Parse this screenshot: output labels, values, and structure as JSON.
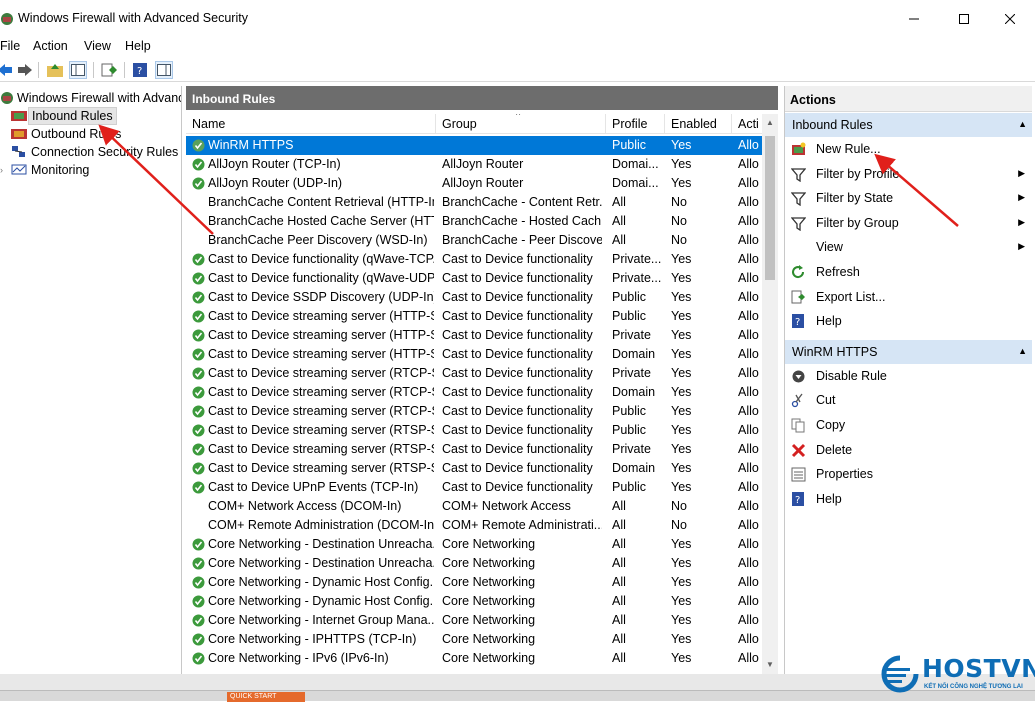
{
  "window": {
    "title": "Windows Firewall with Advanced Security"
  },
  "menu": [
    "File",
    "Action",
    "View",
    "Help"
  ],
  "tree": [
    {
      "label": "Windows Firewall with Advance"
    },
    {
      "label": "Inbound Rules"
    },
    {
      "label": "Outbound Rules"
    },
    {
      "label": "Connection Security Rules"
    },
    {
      "label": "Monitoring"
    }
  ],
  "center": {
    "title": "Inbound Rules",
    "columns": {
      "name": "Name",
      "group": "Group",
      "profile": "Profile",
      "enabled": "Enabled",
      "action": "Acti"
    },
    "rows": [
      {
        "name": "WinRM HTTPS",
        "group": "",
        "profile": "Public",
        "enabled": "Yes",
        "action": "Allo",
        "icon": "check-icon",
        "selected": true
      },
      {
        "name": "AllJoyn Router (TCP-In)",
        "group": "AllJoyn Router",
        "profile": "Domai...",
        "enabled": "Yes",
        "action": "Allo",
        "icon": "check-icon"
      },
      {
        "name": "AllJoyn Router (UDP-In)",
        "group": "AllJoyn Router",
        "profile": "Domai...",
        "enabled": "Yes",
        "action": "Allo",
        "icon": "check-icon"
      },
      {
        "name": "BranchCache Content Retrieval (HTTP-In)",
        "group": "BranchCache - Content Retr...",
        "profile": "All",
        "enabled": "No",
        "action": "Allo",
        "icon": ""
      },
      {
        "name": "BranchCache Hosted Cache Server (HTT...",
        "group": "BranchCache - Hosted Cach...",
        "profile": "All",
        "enabled": "No",
        "action": "Allo",
        "icon": ""
      },
      {
        "name": "BranchCache Peer Discovery (WSD-In)",
        "group": "BranchCache - Peer Discove...",
        "profile": "All",
        "enabled": "No",
        "action": "Allo",
        "icon": ""
      },
      {
        "name": "Cast to Device functionality (qWave-TCP...",
        "group": "Cast to Device functionality",
        "profile": "Private...",
        "enabled": "Yes",
        "action": "Allo",
        "icon": "check-icon"
      },
      {
        "name": "Cast to Device functionality (qWave-UDP...",
        "group": "Cast to Device functionality",
        "profile": "Private...",
        "enabled": "Yes",
        "action": "Allo",
        "icon": "check-icon"
      },
      {
        "name": "Cast to Device SSDP Discovery (UDP-In)",
        "group": "Cast to Device functionality",
        "profile": "Public",
        "enabled": "Yes",
        "action": "Allo",
        "icon": "check-icon"
      },
      {
        "name": "Cast to Device streaming server (HTTP-St...",
        "group": "Cast to Device functionality",
        "profile": "Public",
        "enabled": "Yes",
        "action": "Allo",
        "icon": "check-icon"
      },
      {
        "name": "Cast to Device streaming server (HTTP-St...",
        "group": "Cast to Device functionality",
        "profile": "Private",
        "enabled": "Yes",
        "action": "Allo",
        "icon": "check-icon"
      },
      {
        "name": "Cast to Device streaming server (HTTP-St...",
        "group": "Cast to Device functionality",
        "profile": "Domain",
        "enabled": "Yes",
        "action": "Allo",
        "icon": "check-icon"
      },
      {
        "name": "Cast to Device streaming server (RTCP-St...",
        "group": "Cast to Device functionality",
        "profile": "Private",
        "enabled": "Yes",
        "action": "Allo",
        "icon": "check-icon"
      },
      {
        "name": "Cast to Device streaming server (RTCP-St...",
        "group": "Cast to Device functionality",
        "profile": "Domain",
        "enabled": "Yes",
        "action": "Allo",
        "icon": "check-icon"
      },
      {
        "name": "Cast to Device streaming server (RTCP-St...",
        "group": "Cast to Device functionality",
        "profile": "Public",
        "enabled": "Yes",
        "action": "Allo",
        "icon": "check-icon"
      },
      {
        "name": "Cast to Device streaming server (RTSP-Str...",
        "group": "Cast to Device functionality",
        "profile": "Public",
        "enabled": "Yes",
        "action": "Allo",
        "icon": "check-icon"
      },
      {
        "name": "Cast to Device streaming server (RTSP-Str...",
        "group": "Cast to Device functionality",
        "profile": "Private",
        "enabled": "Yes",
        "action": "Allo",
        "icon": "check-icon"
      },
      {
        "name": "Cast to Device streaming server (RTSP-Str...",
        "group": "Cast to Device functionality",
        "profile": "Domain",
        "enabled": "Yes",
        "action": "Allo",
        "icon": "check-icon"
      },
      {
        "name": "Cast to Device UPnP Events (TCP-In)",
        "group": "Cast to Device functionality",
        "profile": "Public",
        "enabled": "Yes",
        "action": "Allo",
        "icon": "check-icon"
      },
      {
        "name": "COM+ Network Access (DCOM-In)",
        "group": "COM+ Network Access",
        "profile": "All",
        "enabled": "No",
        "action": "Allo",
        "icon": ""
      },
      {
        "name": "COM+ Remote Administration (DCOM-In)",
        "group": "COM+ Remote Administrati...",
        "profile": "All",
        "enabled": "No",
        "action": "Allo",
        "icon": ""
      },
      {
        "name": "Core Networking - Destination Unreacha...",
        "group": "Core Networking",
        "profile": "All",
        "enabled": "Yes",
        "action": "Allo",
        "icon": "check-icon"
      },
      {
        "name": "Core Networking - Destination Unreacha...",
        "group": "Core Networking",
        "profile": "All",
        "enabled": "Yes",
        "action": "Allo",
        "icon": "check-icon"
      },
      {
        "name": "Core Networking - Dynamic Host Config...",
        "group": "Core Networking",
        "profile": "All",
        "enabled": "Yes",
        "action": "Allo",
        "icon": "check-icon"
      },
      {
        "name": "Core Networking - Dynamic Host Config...",
        "group": "Core Networking",
        "profile": "All",
        "enabled": "Yes",
        "action": "Allo",
        "icon": "check-icon"
      },
      {
        "name": "Core Networking - Internet Group Mana...",
        "group": "Core Networking",
        "profile": "All",
        "enabled": "Yes",
        "action": "Allo",
        "icon": "check-icon"
      },
      {
        "name": "Core Networking - IPHTTPS (TCP-In)",
        "group": "Core Networking",
        "profile": "All",
        "enabled": "Yes",
        "action": "Allo",
        "icon": "check-icon"
      },
      {
        "name": "Core Networking - IPv6 (IPv6-In)",
        "group": "Core Networking",
        "profile": "All",
        "enabled": "Yes",
        "action": "Allo",
        "icon": "check-icon"
      }
    ]
  },
  "actions": {
    "header": "Actions",
    "sections": [
      {
        "title": "Inbound Rules",
        "items": [
          {
            "label": "New Rule...",
            "icon": "new-rule-icon"
          },
          {
            "label": "Filter by Profile",
            "icon": "filter-icon",
            "submenu": true
          },
          {
            "label": "Filter by State",
            "icon": "filter-icon",
            "submenu": true
          },
          {
            "label": "Filter by Group",
            "icon": "filter-icon",
            "submenu": true
          },
          {
            "label": "View",
            "icon": "",
            "submenu": true
          },
          {
            "label": "Refresh",
            "icon": "refresh-icon"
          },
          {
            "label": "Export List...",
            "icon": "export-icon"
          },
          {
            "label": "Help",
            "icon": "help-icon"
          }
        ]
      },
      {
        "title": "WinRM HTTPS",
        "items": [
          {
            "label": "Disable Rule",
            "icon": "disable-icon"
          },
          {
            "label": "Cut",
            "icon": "cut-icon"
          },
          {
            "label": "Copy",
            "icon": "copy-icon"
          },
          {
            "label": "Delete",
            "icon": "delete-icon"
          },
          {
            "label": "Properties",
            "icon": "properties-icon"
          },
          {
            "label": "Help",
            "icon": "help-icon"
          }
        ]
      }
    ]
  },
  "statusbar": {
    "chip": "QUICK START"
  },
  "logo": {
    "name": "HOSTVN",
    "tagline": "KẾT NỐI CÔNG NGHỆ TƯƠNG LAI"
  },
  "colors": {
    "selection": "#0078d7",
    "header_gray": "#6d6d6d",
    "section_blue": "#d6e5f5",
    "arrow_red": "#e0201b",
    "logo_blue": "#0e6db5"
  }
}
